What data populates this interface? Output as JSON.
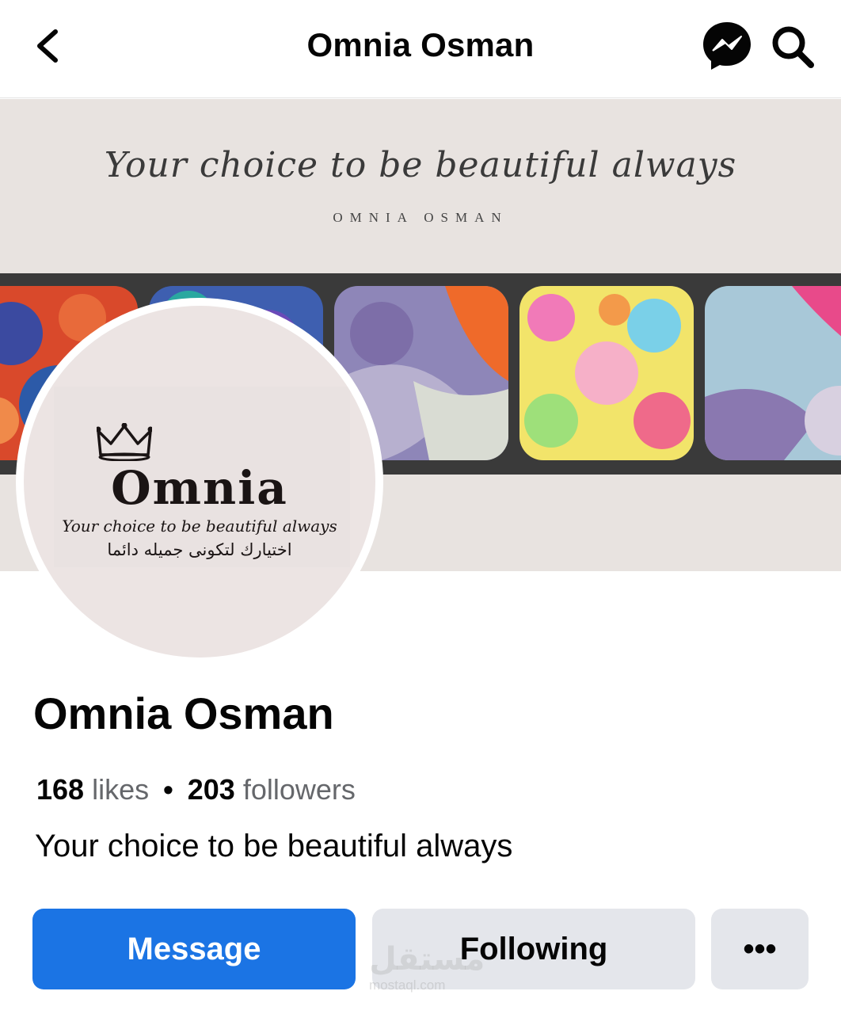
{
  "header": {
    "title": "Omnia Osman",
    "back_icon": "chevron-left-icon",
    "messenger_icon": "messenger-icon",
    "search_icon": "search-icon"
  },
  "cover": {
    "tagline": "Your choice to be beautiful always",
    "brand": "OMNIA  OSMAN"
  },
  "avatar": {
    "logo_name": "Omnia",
    "logo_tagline": "Your choice to be beautiful always",
    "logo_arabic": "اختيارك لتكونى جميله دائما"
  },
  "profile": {
    "name": "Omnia Osman",
    "likes_count": "168",
    "likes_label": "likes",
    "followers_count": "203",
    "followers_label": "followers",
    "separator": "•",
    "bio": "Your choice to be beautiful always"
  },
  "actions": {
    "message_label": "Message",
    "following_label": "Following",
    "more_label": "•••"
  },
  "watermark": {
    "text": "مستقل",
    "sub": "mostaql.com"
  },
  "colors": {
    "accent": "#1b74e4",
    "secondary_button": "#e4e6eb",
    "text_primary": "#050505",
    "text_secondary": "#65676b"
  }
}
